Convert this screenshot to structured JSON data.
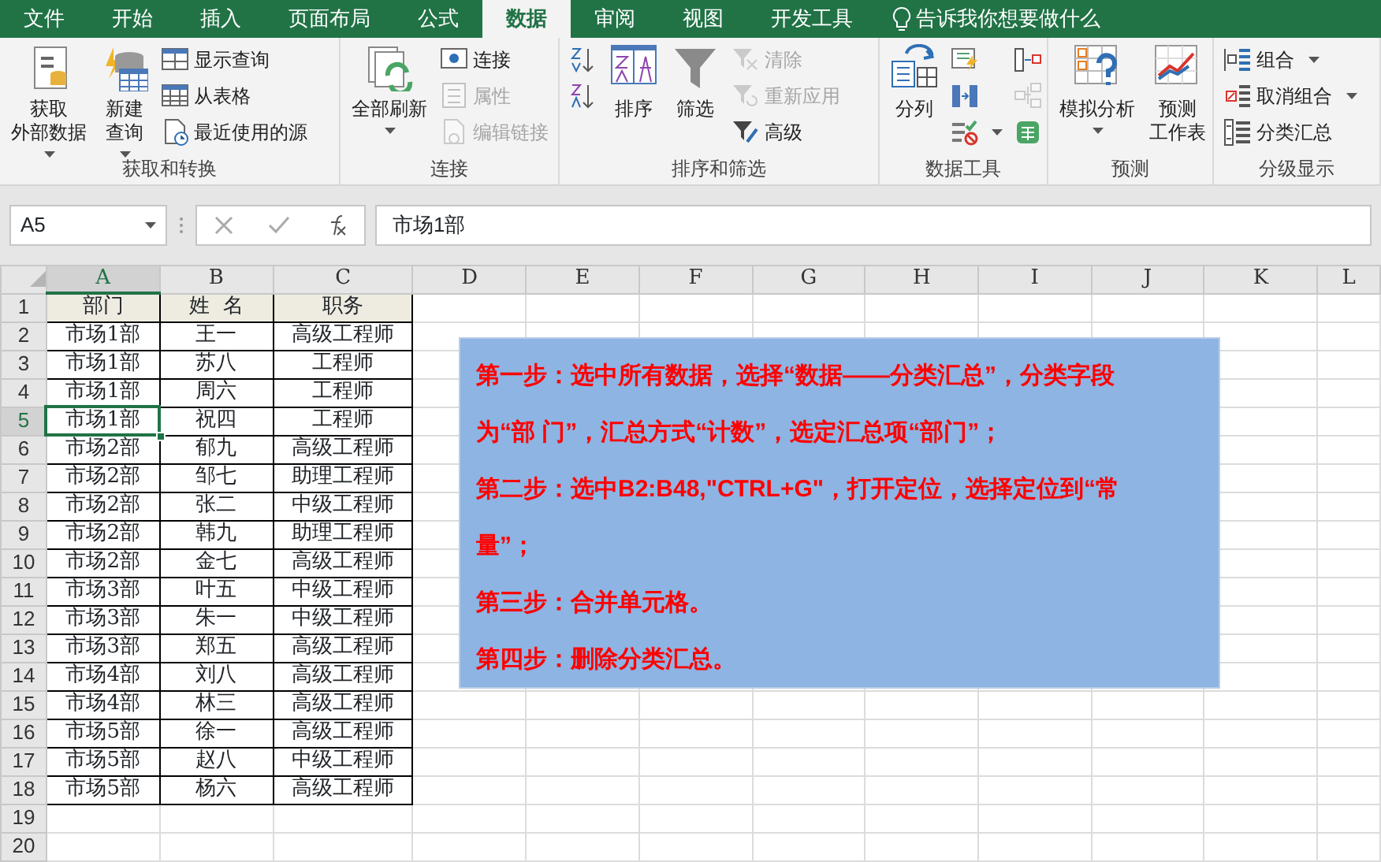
{
  "tabs": [
    {
      "label": "文件",
      "selected": false
    },
    {
      "label": "开始",
      "selected": false
    },
    {
      "label": "插入",
      "selected": false
    },
    {
      "label": "页面布局",
      "selected": false
    },
    {
      "label": "公式",
      "selected": false
    },
    {
      "label": "数据",
      "selected": true
    },
    {
      "label": "审阅",
      "selected": false
    },
    {
      "label": "视图",
      "selected": false
    },
    {
      "label": "开发工具",
      "selected": false
    }
  ],
  "tell_me": "告诉我你想要做什么",
  "ribbon_groups": [
    {
      "label": "获取和转换",
      "buttons": [
        {
          "kind": "large",
          "lines": [
            "获取",
            "外部数据"
          ],
          "dropdown": true,
          "disabled": false
        },
        {
          "kind": "large",
          "lines": [
            "新建",
            "查询"
          ],
          "dropdown": true,
          "disabled": false
        },
        {
          "kind": "small",
          "lines": [
            "显示查询"
          ],
          "dropdown": false,
          "disabled": false
        },
        {
          "kind": "small",
          "lines": [
            "从表格"
          ],
          "dropdown": false,
          "disabled": false
        },
        {
          "kind": "small",
          "lines": [
            "最近使用的源"
          ],
          "dropdown": false,
          "disabled": false
        }
      ]
    },
    {
      "label": "连接",
      "buttons": [
        {
          "kind": "large",
          "lines": [
            "全部刷新"
          ],
          "dropdown": true,
          "disabled": false
        },
        {
          "kind": "small",
          "lines": [
            "连接"
          ],
          "dropdown": false,
          "disabled": false
        },
        {
          "kind": "small",
          "lines": [
            "属性"
          ],
          "dropdown": false,
          "disabled": true
        },
        {
          "kind": "small",
          "lines": [
            "编辑链接"
          ],
          "dropdown": false,
          "disabled": true
        }
      ]
    },
    {
      "label": "排序和筛选",
      "buttons": [
        {
          "kind": "icon",
          "dropdown": false,
          "disabled": false
        },
        {
          "kind": "icon",
          "dropdown": false,
          "disabled": false
        },
        {
          "kind": "large",
          "lines": [
            "排序"
          ],
          "dropdown": false,
          "disabled": false
        },
        {
          "kind": "large",
          "lines": [
            "筛选"
          ],
          "dropdown": false,
          "disabled": false
        },
        {
          "kind": "small",
          "lines": [
            "清除"
          ],
          "dropdown": false,
          "disabled": true
        },
        {
          "kind": "small",
          "lines": [
            "重新应用"
          ],
          "dropdown": false,
          "disabled": true
        },
        {
          "kind": "small",
          "lines": [
            "高级"
          ],
          "dropdown": false,
          "disabled": false
        }
      ]
    },
    {
      "label": "数据工具",
      "buttons": [
        {
          "kind": "large",
          "lines": [
            "分列"
          ],
          "dropdown": false,
          "disabled": false
        },
        {
          "kind": "icon",
          "dropdown": false,
          "disabled": false
        },
        {
          "kind": "icon",
          "dropdown": false,
          "disabled": false
        },
        {
          "kind": "icon",
          "dropdown": true,
          "disabled": false
        },
        {
          "kind": "icon",
          "dropdown": false,
          "disabled": false
        },
        {
          "kind": "icon",
          "dropdown": false,
          "disabled": true
        },
        {
          "kind": "icon",
          "dropdown": false,
          "disabled": false
        }
      ]
    },
    {
      "label": "预测",
      "buttons": [
        {
          "kind": "large",
          "lines": [
            "模拟分析"
          ],
          "dropdown": true,
          "disabled": false
        },
        {
          "kind": "large",
          "lines": [
            "预测",
            "工作表"
          ],
          "dropdown": false,
          "disabled": false
        }
      ]
    },
    {
      "label": "分级显示",
      "buttons": [
        {
          "kind": "small",
          "lines": [
            "组合"
          ],
          "dropdown": true,
          "disabled": false
        },
        {
          "kind": "small",
          "lines": [
            "取消组合"
          ],
          "dropdown": true,
          "disabled": false
        },
        {
          "kind": "small",
          "lines": [
            "分类汇总"
          ],
          "dropdown": false,
          "disabled": false
        }
      ]
    }
  ],
  "formula_bar": {
    "name_box": "A5",
    "value": "市场1部"
  },
  "columns": [
    {
      "label": "A",
      "selected": true
    },
    {
      "label": "B",
      "selected": false
    },
    {
      "label": "C",
      "selected": false
    },
    {
      "label": "D",
      "selected": false
    },
    {
      "label": "E",
      "selected": false
    },
    {
      "label": "F",
      "selected": false
    },
    {
      "label": "G",
      "selected": false
    },
    {
      "label": "H",
      "selected": false
    },
    {
      "label": "I",
      "selected": false
    },
    {
      "label": "J",
      "selected": false
    },
    {
      "label": "K",
      "selected": false
    },
    {
      "label": "L",
      "selected": false
    }
  ],
  "header_row": {
    "number": "1",
    "cells": [
      "部门",
      "姓  名",
      "职务"
    ]
  },
  "rows": [
    {
      "number": "2",
      "selected": false,
      "cells": [
        "市场1部",
        "王一",
        "高级工程师"
      ]
    },
    {
      "number": "3",
      "selected": false,
      "cells": [
        "市场1部",
        "苏八",
        "工程师"
      ]
    },
    {
      "number": "4",
      "selected": false,
      "cells": [
        "市场1部",
        "周六",
        "工程师"
      ]
    },
    {
      "number": "5",
      "selected": true,
      "cells": [
        "市场1部",
        "祝四",
        "工程师"
      ]
    },
    {
      "number": "6",
      "selected": false,
      "cells": [
        "市场2部",
        "郁九",
        "高级工程师"
      ]
    },
    {
      "number": "7",
      "selected": false,
      "cells": [
        "市场2部",
        "邹七",
        "助理工程师"
      ]
    },
    {
      "number": "8",
      "selected": false,
      "cells": [
        "市场2部",
        "张二",
        "中级工程师"
      ]
    },
    {
      "number": "9",
      "selected": false,
      "cells": [
        "市场2部",
        "韩九",
        "助理工程师"
      ]
    },
    {
      "number": "10",
      "selected": false,
      "cells": [
        "市场2部",
        "金七",
        "高级工程师"
      ]
    },
    {
      "number": "11",
      "selected": false,
      "cells": [
        "市场3部",
        "叶五",
        "中级工程师"
      ]
    },
    {
      "number": "12",
      "selected": false,
      "cells": [
        "市场3部",
        "朱一",
        "中级工程师"
      ]
    },
    {
      "number": "13",
      "selected": false,
      "cells": [
        "市场3部",
        "郑五",
        "高级工程师"
      ]
    },
    {
      "number": "14",
      "selected": false,
      "cells": [
        "市场4部",
        "刘八",
        "高级工程师"
      ]
    },
    {
      "number": "15",
      "selected": false,
      "cells": [
        "市场4部",
        "林三",
        "高级工程师"
      ]
    },
    {
      "number": "16",
      "selected": false,
      "cells": [
        "市场5部",
        "徐一",
        "高级工程师"
      ]
    },
    {
      "number": "17",
      "selected": false,
      "cells": [
        "市场5部",
        "赵八",
        "中级工程师"
      ]
    },
    {
      "number": "18",
      "selected": false,
      "cells": [
        "市场5部",
        "杨六",
        "高级工程师"
      ]
    },
    {
      "number": "19",
      "selected": false
    },
    {
      "number": "20",
      "selected": false
    }
  ],
  "text_box": {
    "paragraphs": [
      "第一步：选中所有数据，选择“数据——分类汇总”，分类字段为“部 门”，汇总方式“计数”，选定汇总项“部门”；",
      "第二步：选中B2:B48,\"CTRL+G\"，打开定位，选择定位到“常量”；",
      "第三步：合并单元格。",
      "第四步：删除分类汇总。"
    ]
  }
}
